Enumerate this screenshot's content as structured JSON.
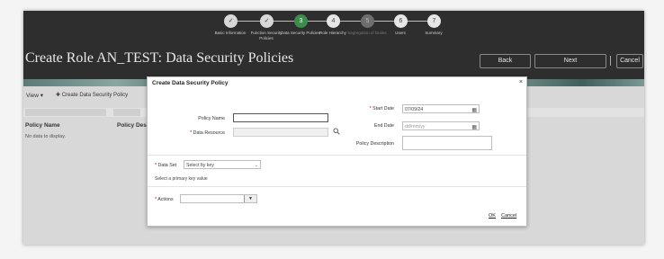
{
  "train": {
    "steps": [
      {
        "marker": "✓",
        "label": "Basic Information",
        "state": "done"
      },
      {
        "marker": "✓",
        "label": "Function Security Policies",
        "state": "done"
      },
      {
        "marker": "3",
        "label": "Data Security Policies",
        "state": "current"
      },
      {
        "marker": "4",
        "label": "Role Hierarchy",
        "state": "todo"
      },
      {
        "marker": "5",
        "label": "Segregation of Duties",
        "state": "disabled"
      },
      {
        "marker": "6",
        "label": "Users",
        "state": "todo"
      },
      {
        "marker": "7",
        "label": "Summary",
        "state": "todo"
      }
    ]
  },
  "page_title": "Create Role AN_TEST: Data Security Policies",
  "header_buttons": {
    "back": "Back",
    "next": "Next",
    "cancel": "Cancel"
  },
  "toolbar": {
    "view": "View ▾",
    "add_icon": "plus-icon",
    "add_label": "Create Data Security Policy"
  },
  "table": {
    "columns": [
      "Policy Name",
      "Policy Des"
    ],
    "empty_text": "No data to display."
  },
  "dialog": {
    "title": "Create Data Security Policy",
    "close": "×",
    "policy_name_label": "Policy Name",
    "policy_name_value": "",
    "data_resource_label": "Data Resource",
    "data_resource_value": "",
    "search_icon": "search-icon",
    "start_date_label": "Start Date",
    "start_date_value": "07/09/24",
    "end_date_label": "End Date",
    "end_date_placeholder": "dd/mm/yy",
    "calendar_icon": "calendar-icon",
    "description_label": "Policy Description",
    "description_value": "",
    "data_set_label": "Data Set",
    "data_set_value": "Select by key",
    "data_set_hint": "Select a primary key value",
    "actions_label": "Actions",
    "actions_value": "",
    "ok": "OK",
    "cancel": "Cancel"
  },
  "colors": {
    "header": "#2e2e2e",
    "current_step": "#3c8c4c",
    "required": "#b00000"
  }
}
